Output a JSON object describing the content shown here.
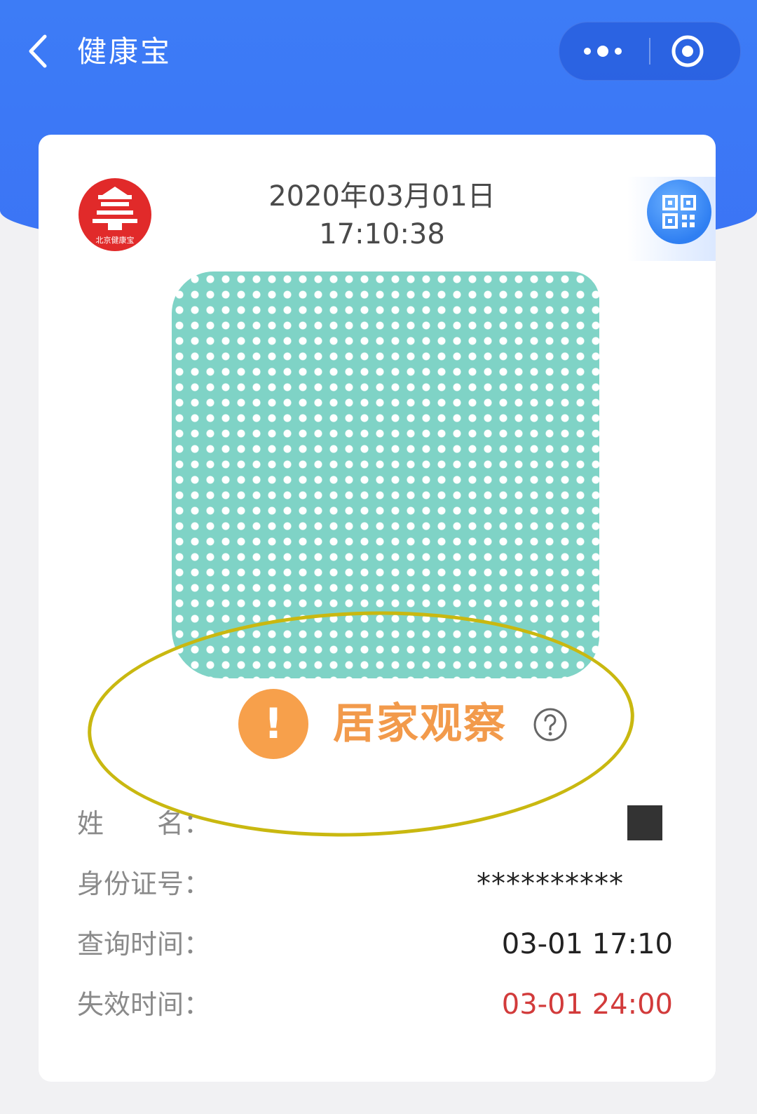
{
  "nav": {
    "title": "健康宝",
    "back_icon": "chevron-left-icon",
    "more_icon": "more-dots-icon",
    "close_icon": "target-circle-icon"
  },
  "card": {
    "logo": {
      "icon": "beijing-health-kit-logo",
      "caption": "北京健康宝"
    },
    "date": "2020年03月01日",
    "time": "17:10:38",
    "qr_icon": "qr-code-icon",
    "status": {
      "label": "居家观察",
      "icon": "exclamation-icon",
      "help_icon": "question-circle-icon",
      "color": "#f29a4b"
    },
    "info": [
      {
        "label": "姓　　名：",
        "value": ""
      },
      {
        "label": "身份证号：",
        "value": "**********"
      },
      {
        "label": "查询时间：",
        "value": "03-01 17:10"
      },
      {
        "label": "失效时间：",
        "value": "03-01 24:00"
      }
    ]
  },
  "colors": {
    "header_blue": "#3d7cf6",
    "code_teal": "#7fd3c6",
    "expiry_red": "#d23b3b",
    "highlight_ring": "#c9b810"
  }
}
